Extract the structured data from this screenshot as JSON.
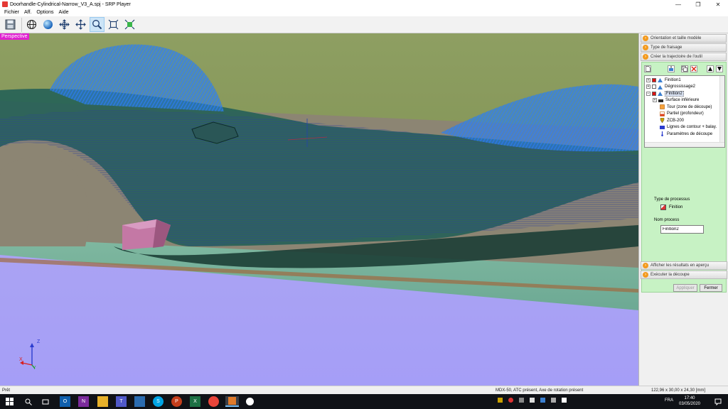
{
  "window": {
    "title": "Doorhandle-Cylindrical-Narrow_V3_A.spj - SRP Player",
    "minimize": "—",
    "maximize": "❐",
    "close": "✕"
  },
  "menu": [
    "Fichier",
    "Aff.",
    "Options",
    "Aide"
  ],
  "toolbar": {
    "tools": [
      "save-icon",
      "globe-icon",
      "sphere-icon",
      "rotate-axes-icon",
      "move-icon",
      "zoom-icon",
      "fit-view-icon",
      "fit-all-icon"
    ],
    "active_tool": "zoom-icon"
  },
  "viewport": {
    "view_label": "Perspective",
    "axes": {
      "x": "X",
      "y": "Y",
      "z": "Z"
    }
  },
  "panel": {
    "steps_top": [
      "Orientation et taille modèle",
      "Type de fraisage",
      "Créer la trajectoire de l'outil"
    ],
    "tree": [
      {
        "label": "Finition1",
        "level": 0,
        "expander": "+",
        "checked": true
      },
      {
        "label": "Dégrossissage2",
        "level": 0,
        "expander": "+",
        "checked": false
      },
      {
        "label": "Finition2",
        "level": 0,
        "expander": "−",
        "checked": true,
        "selected": true
      },
      {
        "label": "Surface inférieure",
        "level": 1,
        "expander": "+"
      },
      {
        "label": "Tour (zone de découpe)",
        "level": 2
      },
      {
        "label": "Partiel (profondeur)",
        "level": 2
      },
      {
        "label": "ZCB-200",
        "level": 2
      },
      {
        "label": "Lignes de contour + balay.",
        "level": 2
      },
      {
        "label": "Paramètres de découpe",
        "level": 2
      }
    ],
    "process_type_label": "Type de processus",
    "process_type_value": "Finition",
    "process_name_label": "Nom process",
    "process_name_value": "Finition2",
    "apply_button": "Appliquer",
    "close_button": "Fermer",
    "steps_bottom": [
      "Afficher les résultats en aperçu",
      "Exécuter la découpe"
    ]
  },
  "status": {
    "left": "Prêt",
    "machine": "MDX-50, ATC présent, Axe de rotation présent",
    "dimensions": "122,96 x 30,00 x 24,30 [mm]"
  },
  "taskbar": {
    "language": "FRA",
    "time": "17:40",
    "date": "03/05/2020"
  },
  "colors": {
    "accent": "#e020d0",
    "step_icon": "#f39a1e",
    "panel_green": "#c7f2c4",
    "toolpath": "#1a5ee0",
    "workpiece_top": "#8fa060",
    "floor": "#a9a3f5"
  }
}
